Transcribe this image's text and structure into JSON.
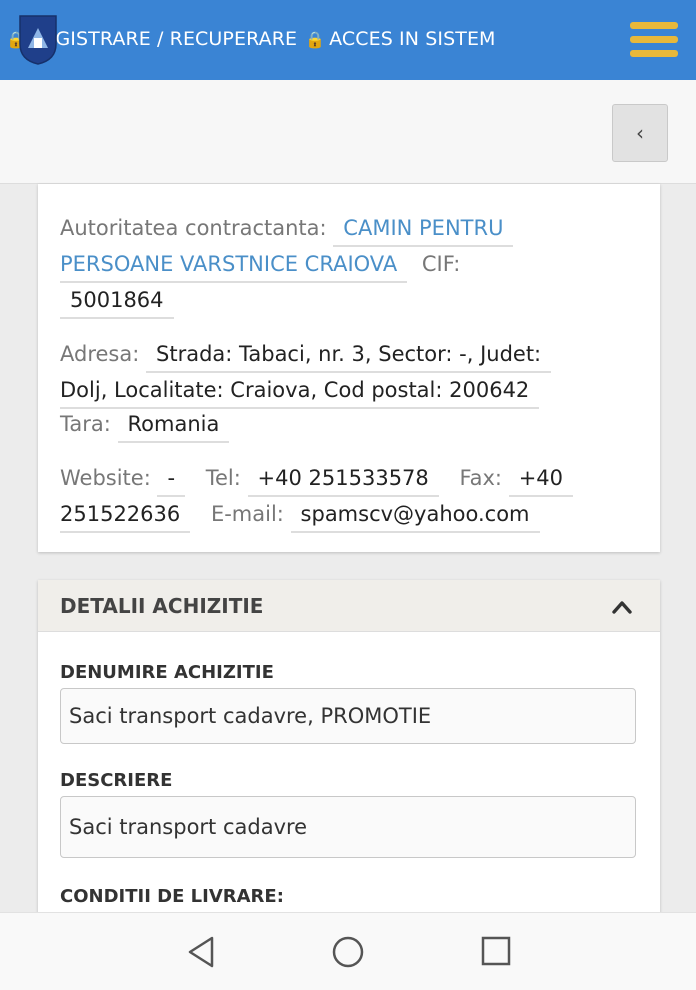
{
  "header": {
    "link_register": "REGISTRARE / RECUPERARE",
    "link_access": "ACCES IN SISTEM",
    "lock_icon": "lock-icon",
    "menu_icon": "hamburger-menu-icon"
  },
  "subheader": {
    "back_label": "‹"
  },
  "authority": {
    "contracting_label": "Autoritatea contractanta:",
    "contracting_value_1": "CAMIN PENTRU",
    "contracting_value_2": "PERSOANE VARSTNICE CRAIOVA",
    "cif_label": "CIF:",
    "cif_value": "5001864",
    "address_label": "Adresa:",
    "address_value_1": "Strada: Tabaci, nr. 3, Sector: -, Judet:",
    "address_value_2": "Dolj, Localitate: Craiova, Cod postal: 200642",
    "country_label": "Tara:",
    "country_value": "Romania",
    "website_label": "Website:",
    "website_value": "-",
    "tel_label": "Tel:",
    "tel_value": "+40 251533578",
    "fax_label": "Fax:",
    "fax_value_1": "+40",
    "fax_value_2": "251522636",
    "email_label": "E-mail:",
    "email_value": "spamscv@yahoo.com"
  },
  "details": {
    "title": "DETALII ACHIZITIE",
    "name_label": "DENUMIRE ACHIZITIE",
    "name_value": "Saci transport cadavre, PROMOTIE",
    "desc_label": "DESCRIERE",
    "desc_value": "Saci transport cadavre",
    "delivery_label": "CONDITII DE LIVRARE:"
  },
  "colors": {
    "topbar": "#3a84d4",
    "menu_icon": "#e8b83a",
    "link": "#4a8fc8"
  }
}
